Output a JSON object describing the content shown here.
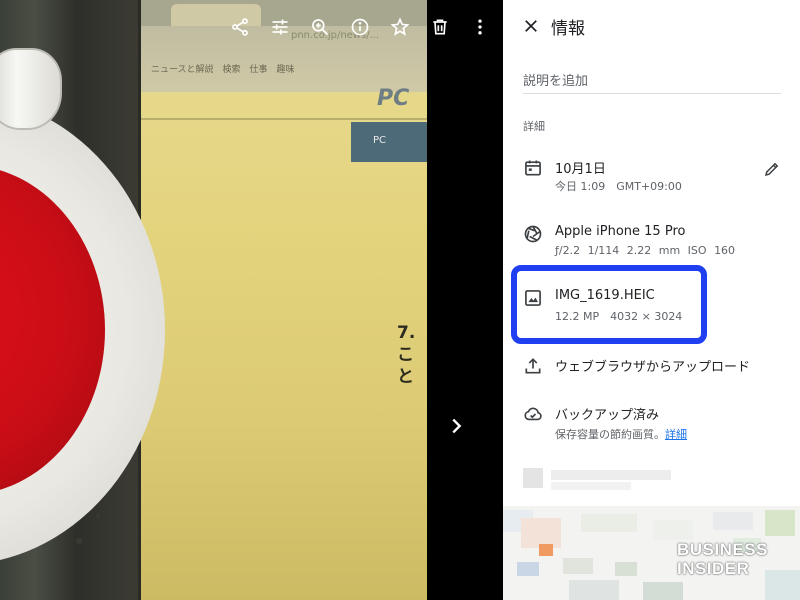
{
  "viewer": {
    "toolbar": [
      {
        "name": "share-icon"
      },
      {
        "name": "edit-adjust-icon"
      },
      {
        "name": "zoom-in-icon"
      },
      {
        "name": "info-icon"
      },
      {
        "name": "favorite-star-icon"
      },
      {
        "name": "delete-trash-icon"
      },
      {
        "name": "more-vert-icon"
      }
    ],
    "next_icon": "chevron-right-icon",
    "photo": {
      "url_text": "pnn.co.jp/news/...",
      "bookmarks": "ニュースと解説　検索　仕事　趣味",
      "site_logo": "PC",
      "site_nav": "PC",
      "heading_line1": "7.",
      "heading_line2": "こと"
    }
  },
  "panel": {
    "title": "情報",
    "close_icon": "close-icon",
    "description_placeholder": "説明を追加",
    "details_label": "詳細",
    "date": {
      "icon": "calendar-icon",
      "primary": "10月1日",
      "secondary": "今日 1:09　GMT+09:00",
      "edit_icon": "edit-pencil-icon"
    },
    "camera": {
      "icon": "camera-aperture-icon",
      "primary": "Apple iPhone 15 Pro",
      "secondary": "ƒ/2.2  1/114  2.22 mm  ISO 160"
    },
    "file": {
      "icon": "image-icon",
      "primary": "IMG_1619.HEIC",
      "secondary": "12.2 MP　4032 × 3024",
      "highlight_color": "#1f3ff0"
    },
    "upload": {
      "icon": "upload-icon",
      "primary": "ウェブブラウザからアップロード"
    },
    "backup": {
      "icon": "cloud-done-icon",
      "primary": "バックアップ済み",
      "secondary": "保存容量の節約画質。",
      "link": "詳細"
    }
  },
  "watermark": {
    "line1": "BUSINESS",
    "line2": "INSIDER"
  }
}
